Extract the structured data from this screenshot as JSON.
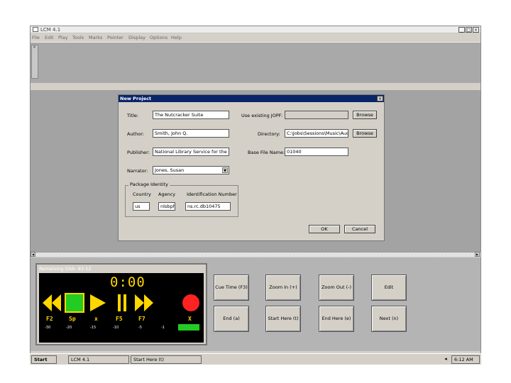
{
  "window": {
    "title": "LCM 4.1",
    "controls": [
      "_",
      "□",
      "×"
    ]
  },
  "menu": [
    "File",
    "Edit",
    "Play",
    "Tools",
    "Marks",
    "Pointer",
    "Display",
    "Options",
    "Help"
  ],
  "side_handle": "×",
  "dialog": {
    "title": "New Project",
    "close": "×",
    "labels": {
      "title": "Title:",
      "author": "Author:",
      "publisher": "Publisher:",
      "narrator": "Narrator:",
      "use_existing": "Use existing JOPF:",
      "directory": "Directory:",
      "base_file": "Base File Name:",
      "package": "Package Identity",
      "country": "Country",
      "agency": "Agency",
      "identification": "Identification Number"
    },
    "values": {
      "title": "The Nutcracker Suite",
      "author": "Smith, John Q.",
      "publisher": "National Library Service for the Blind",
      "narrator": "Jones, Susan",
      "directory": "C:\\Jobs\\Sessions\\Music\\Audio",
      "base_file": "01040",
      "country": "us",
      "agency": "nlsbph",
      "identification": "ns.rc.db10475"
    },
    "buttons": {
      "browse1": "Browse",
      "browse2": "Browse",
      "ok": "OK",
      "cancel": "Cancel"
    }
  },
  "player": {
    "remaining": "Remaining Disk: 83:12",
    "time": "0:00",
    "fkeys": [
      "F2",
      "Sp",
      "x",
      "F5",
      "F7",
      "X"
    ],
    "numbers": [
      "-30",
      "-20",
      "-15",
      "-10",
      "-5",
      "-1"
    ]
  },
  "commands": {
    "cue_time": "Cue Time (F3)",
    "zoom_in": "Zoom In (+)",
    "zoom_out": "Zoom Out (-)",
    "edit": "Edit",
    "end": "End (a)",
    "start_here": "Start Here (t)",
    "end_here": "End Here (e)",
    "next": "Next (n)"
  },
  "taskbar": {
    "start": "Start",
    "app": "LCM 4.1",
    "task2": "Start Here (t)",
    "clock": "6:12 AM"
  },
  "colors": {
    "dialog_title": "#0a246a",
    "time_digits": "#ffd700",
    "play_green": "#22cc22",
    "stop_red": "#ff2222"
  }
}
